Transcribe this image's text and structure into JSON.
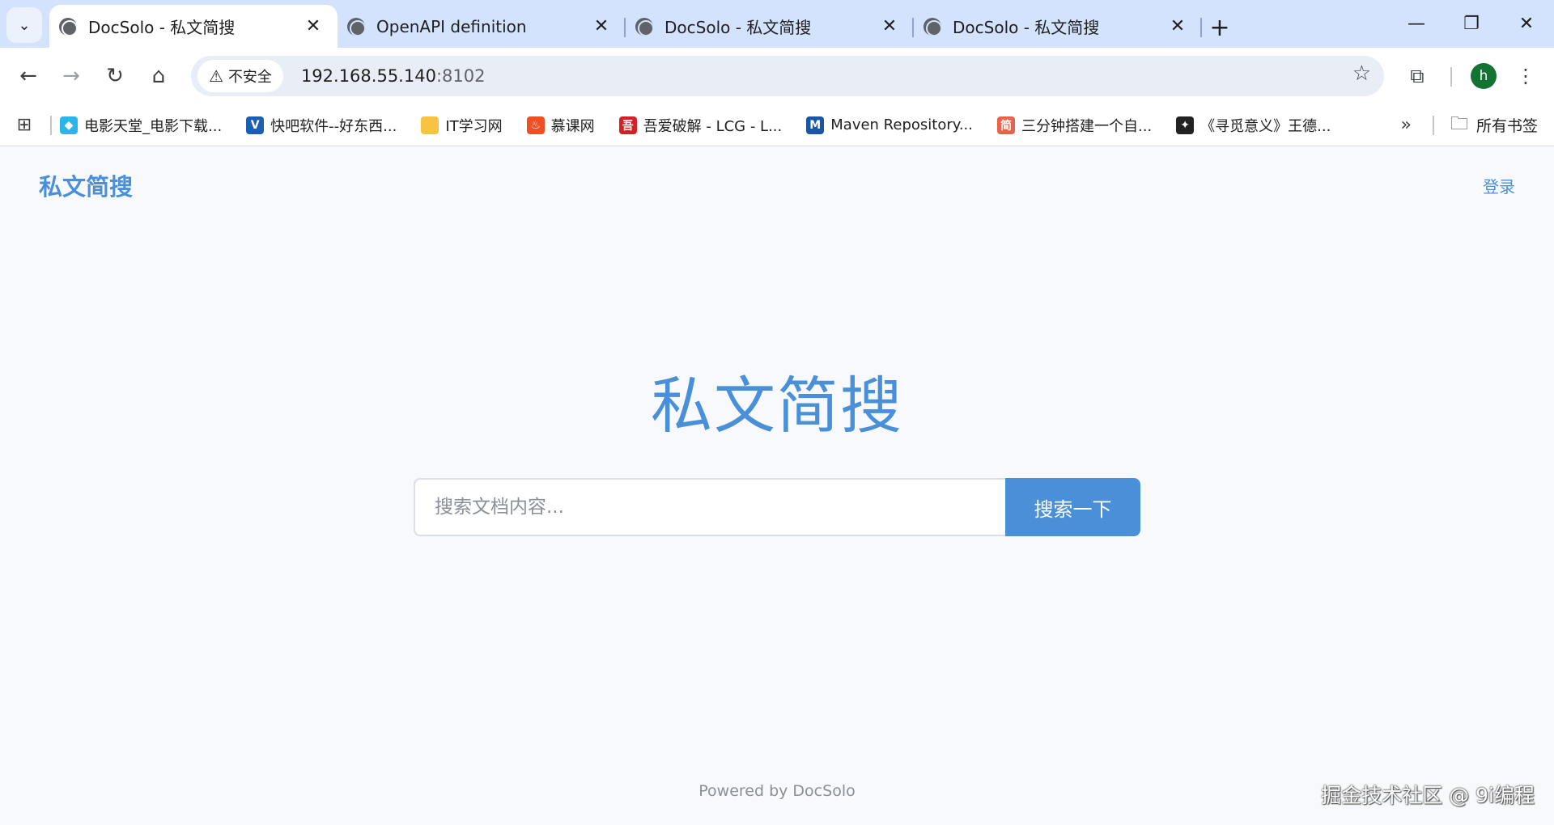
{
  "browser": {
    "tabs": [
      {
        "title": "DocSolo - 私文简搜",
        "active": true
      },
      {
        "title": "OpenAPI definition",
        "active": false
      },
      {
        "title": "DocSolo - 私文简搜",
        "active": false
      },
      {
        "title": "DocSolo - 私文简搜",
        "active": false
      }
    ],
    "new_tab_label": "+",
    "security_label": "不安全",
    "url_host": "192.168.55.140",
    "url_port": ":8102",
    "profile_initial": "h"
  },
  "bookmarks": [
    {
      "label": "电影天堂_电影下载...",
      "icon_color": "#2bb5e8",
      "icon_char": "◆"
    },
    {
      "label": "快吧软件--好东西...",
      "icon_color": "#1a5fb4",
      "icon_char": "V"
    },
    {
      "label": "IT学习网",
      "icon_color": "#f6c343",
      "icon_char": ""
    },
    {
      "label": "慕课网",
      "icon_color": "#f04e23",
      "icon_char": "♨"
    },
    {
      "label": "吾爱破解 - LCG - L...",
      "icon_color": "#d42027",
      "icon_char": "吾"
    },
    {
      "label": "Maven Repository...",
      "icon_color": "#1a56a6",
      "icon_char": "M"
    },
    {
      "label": "三分钟搭建一个自...",
      "icon_color": "#ec6149",
      "icon_char": "简"
    },
    {
      "label": "《寻觅意义》王德...",
      "icon_color": "#222222",
      "icon_char": "✦"
    }
  ],
  "bookmarks_folder": "所有书签",
  "page": {
    "brand": "私文简搜",
    "login": "登录",
    "hero_title": "私文简搜",
    "search": {
      "placeholder": "搜索文档内容...",
      "button": "搜索一下"
    },
    "footer": "Powered by DocSolo"
  },
  "watermark": "掘金技术社区 @ 9i编程",
  "colors": {
    "accent": "#4a90d9",
    "tabstrip": "#d3e3fd",
    "page_bg": "#f7f9fc"
  }
}
